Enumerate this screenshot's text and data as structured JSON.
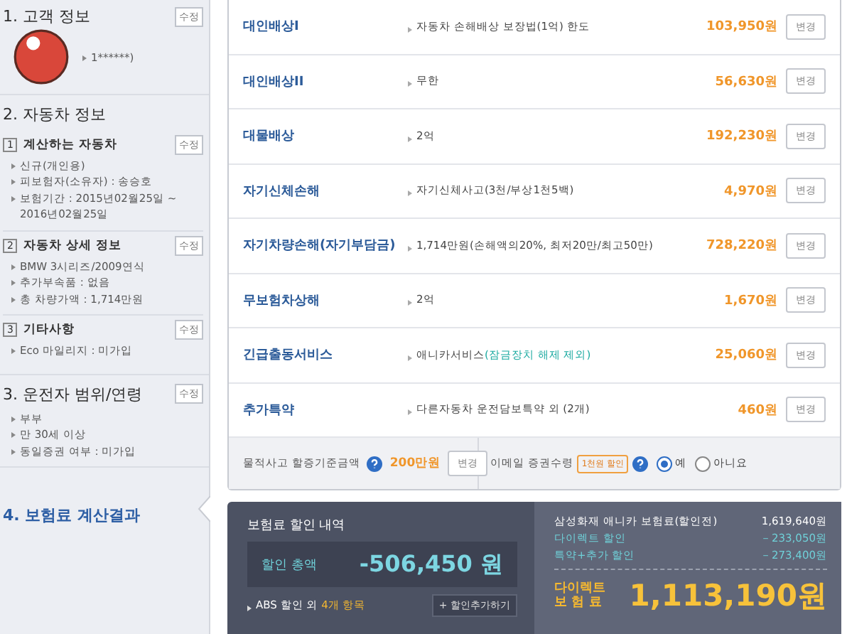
{
  "sidebar": {
    "sections": [
      {
        "title": "1. 고객 정보",
        "edit": "수정",
        "selected": false,
        "items": [
          "1******)"
        ]
      },
      {
        "title": "2. 자동차 정보",
        "selected": false,
        "groups": [
          {
            "number": "1",
            "title": "계산하는 자동차",
            "edit": "수정",
            "items": [
              "신규(개인용)",
              "피보험자(소유자) : 송승호",
              "보험기간 : 2015년02월25일 ~ 2016년02월25일"
            ]
          },
          {
            "number": "2",
            "title": "자동차 상세 정보",
            "edit": "수정",
            "items": [
              "BMW 3시리즈/2009연식",
              "추가부속품 : 없음",
              "총 차량가액 : 1,714만원"
            ]
          },
          {
            "number": "3",
            "title": "기타사항",
            "edit": "수정",
            "items": [
              "Eco 마일리지 : 미가입"
            ]
          }
        ]
      },
      {
        "title": "3. 운전자 범위/연령",
        "edit": "수정",
        "selected": false,
        "items": [
          "부부",
          "만 30세 이상",
          "동일증권 여부 : 미가입"
        ]
      },
      {
        "title": "4. 보험료 계산결과",
        "selected": true
      }
    ]
  },
  "coverages": [
    {
      "name": "대인배상I",
      "desc": "자동차 손해배상 보장법(1억) 한도",
      "price": "103,950원",
      "button": "변경"
    },
    {
      "name": "대인배상II",
      "desc": "무한",
      "price": "56,630원",
      "button": "변경"
    },
    {
      "name": "대물배상",
      "desc": "2억",
      "price": "192,230원",
      "button": "변경"
    },
    {
      "name": "자기신체손해",
      "desc": "자기신체사고(3천/부상1천5백)",
      "price": "4,970원",
      "button": "변경"
    },
    {
      "name": "자기차량손해(자기부담금)",
      "desc": "1,714만원(손해액의20%, 최저20만/최고50만)",
      "price": "728,220원",
      "button": "변경"
    },
    {
      "name": "무보험차상해",
      "desc": "2억",
      "price": "1,670원",
      "button": "변경"
    },
    {
      "name": "긴급출동서비스",
      "desc": "애니카서비스",
      "desc_note": "(잠금장치 해제 제외)",
      "price": "25,060원",
      "button": "변경"
    },
    {
      "name": "추가특약",
      "desc": "다른자동차 운전담보특약 외 (2개)",
      "price": "460원",
      "button": "변경"
    }
  ],
  "options": {
    "surcharge": {
      "label": "물적사고 할증기준금액",
      "value": "200만원",
      "button": "변경"
    },
    "email": {
      "label": "이메일 증권수령",
      "badge": "1천원 할인",
      "radios": [
        {
          "label": "예",
          "selected": true
        },
        {
          "label": "아니요",
          "selected": false
        }
      ]
    }
  },
  "discount": {
    "title": "보험료 할인 내역",
    "total_label": "할인 총액",
    "amount": "-506,450",
    "unit": "원",
    "note": "ABS 할인 외",
    "note_highlight": "4개 항목",
    "button": "+ 할인추가하기",
    "lines": [
      {
        "label": "삼성화재 애니카 보험료(할인전)",
        "value": "1,619,640원",
        "kind": "base"
      },
      {
        "label": "다이렉트 할인",
        "value": "－233,050원",
        "kind": "discount"
      },
      {
        "label": "특약+추가 할인",
        "value": "－273,400원",
        "kind": "discount"
      }
    ],
    "final_label": [
      "다이렉트",
      "보 험 료"
    ],
    "final_amount": "1,113,190원"
  }
}
